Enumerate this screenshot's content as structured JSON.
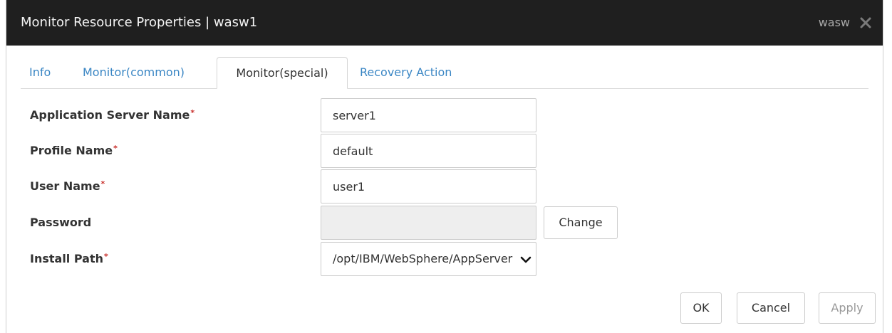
{
  "window": {
    "title": "Monitor Resource Properties | wasw1",
    "user": "wasw",
    "close_icon": "close-icon"
  },
  "tabs": [
    {
      "label": "Info",
      "active": false
    },
    {
      "label": "Monitor(common)",
      "active": false
    },
    {
      "label": "Monitor(special)",
      "active": true
    },
    {
      "label": "Recovery Action",
      "active": false
    }
  ],
  "form": {
    "required_mark": "*",
    "app_server_name": {
      "label": "Application Server Name",
      "value": "server1"
    },
    "profile_name": {
      "label": "Profile Name",
      "value": "default"
    },
    "user_name": {
      "label": "User Name",
      "value": "user1"
    },
    "password": {
      "label": "Password",
      "value": "",
      "change_label": "Change"
    },
    "install_path": {
      "label": "Install Path",
      "value": "/opt/IBM/WebSphere/AppServer"
    }
  },
  "footer": {
    "ok_label": "OK",
    "cancel_label": "Cancel",
    "apply_label": "Apply"
  },
  "colors": {
    "titlebar_bg": "#1f1f1f",
    "tab_link": "#3a86c4",
    "required": "#c9302c"
  }
}
